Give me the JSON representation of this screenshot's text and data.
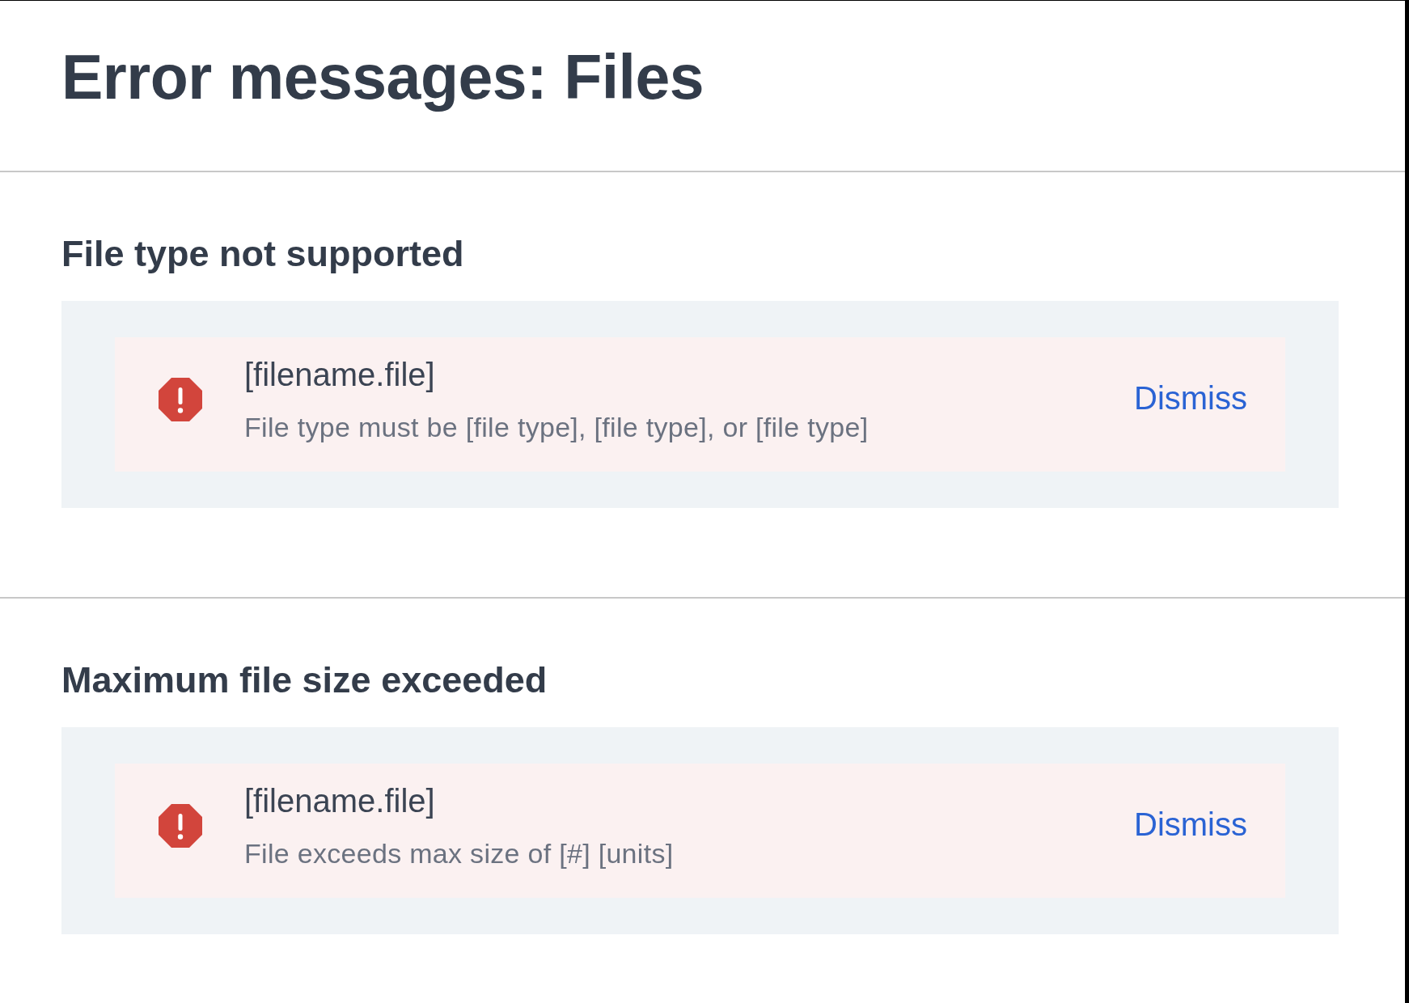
{
  "title": "Error messages: Files",
  "sections": [
    {
      "heading": "File type not supported",
      "alert": {
        "kind": "error",
        "filename": "[filename.file]",
        "message": "File type must be [file type], [file type], or [file type]",
        "action": "Dismiss"
      }
    },
    {
      "heading": "Maximum file size exceeded",
      "alert": {
        "kind": "error",
        "filename": "[filename.file]",
        "message": "File exceeds max size of [#] [units]",
        "action": "Dismiss"
      }
    }
  ]
}
